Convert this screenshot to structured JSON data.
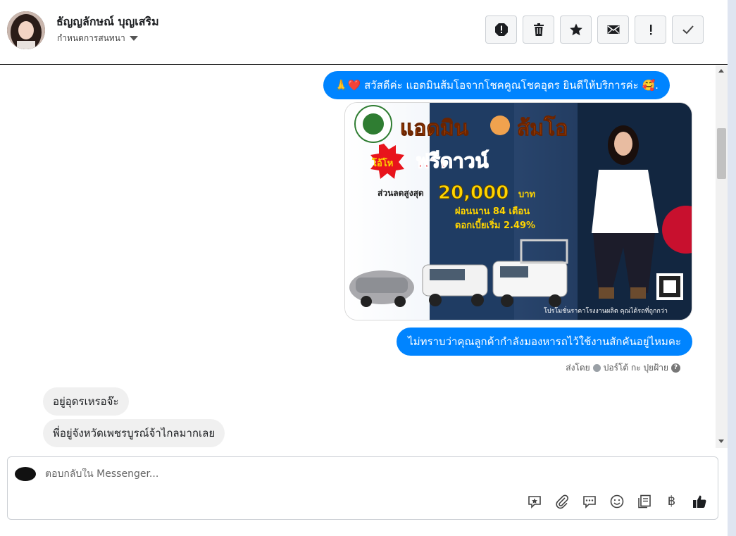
{
  "contact": {
    "name": "ธัญญลักษณ์ บุญเสริม",
    "assign_label": "กำหนดการสนทนา"
  },
  "toolbar": {
    "buttons": [
      {
        "icon": "spam-icon",
        "label": "Mark as spam"
      },
      {
        "icon": "trash-icon",
        "label": "Delete"
      },
      {
        "icon": "star-icon",
        "label": "Star"
      },
      {
        "icon": "mail-icon",
        "label": "Mark as unread"
      },
      {
        "icon": "exclamation-icon",
        "label": "Follow up"
      },
      {
        "icon": "check-icon",
        "label": "Done"
      }
    ]
  },
  "messages": {
    "greeting": "🙏❤️ สวัสดีค่ะ แอดมินส้มโอจากโชคคูณโชคอุดร ยินดีให้บริการค่ะ 🥰.",
    "question": "ไม่ทราบว่าคุณลูกค้ากำลังมองหารถไว้ใช้งานสักคันอยู่ไหมคะ",
    "sent_by_prefix": "ส่งโดย",
    "sent_by_name": "ปอร์โต้ กะ ปุยฝ้าย",
    "incoming_1": "อยู่อุดรเหรอจ๊ะ",
    "incoming_2": "พี่อยู่จังหวัดเพชรบูรณ์จ้าไกลมากเลย"
  },
  "promo": {
    "headline_1": "แอดมิน",
    "headline_2": "ส้มโอ",
    "burst": "โอ้โห",
    "free_down": "ฟรีดาวน์",
    "discount_prefix": "ส่วนลดสูงสุด",
    "discount_amount": "20,000",
    "discount_unit": "บาท",
    "installment": "ผ่อนนาน 84 เดือน",
    "interest": "ดอกเบี้ยเริ่ม 2.49%",
    "footer": "โปรโมชั่นราคาโรงงานผลิต คุณได้รถที่ถูกกว่า",
    "colors": {
      "headline": "#ff6a00",
      "freedown": "#e8141c",
      "accent": "#ffd400",
      "seat": "#1f3c63"
    }
  },
  "composer": {
    "placeholder": "ตอบกลับใน Messenger...",
    "tools": [
      "saved-reply-icon",
      "attach-icon",
      "chat-icon",
      "emoji-icon",
      "notes-icon",
      "baht-icon",
      "like-icon"
    ],
    "baht_symbol": "฿"
  }
}
